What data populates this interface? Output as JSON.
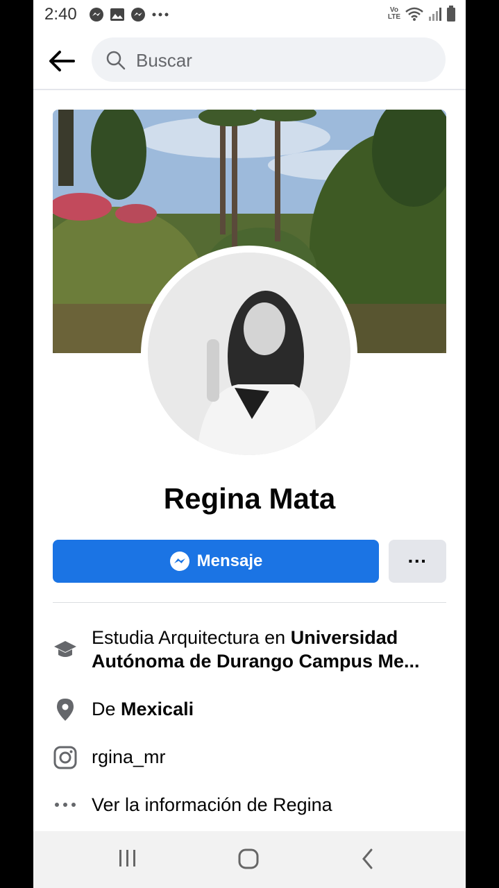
{
  "status_bar": {
    "time": "2:40",
    "left_icons": [
      "messenger-icon",
      "image-icon",
      "messenger-icon",
      "more-dots-icon"
    ],
    "right_icons": [
      "volte-icon",
      "wifi-icon",
      "signal-icon",
      "battery-icon"
    ],
    "volte_text": "Vo LTE"
  },
  "search": {
    "placeholder": "Buscar"
  },
  "profile": {
    "name": "Regina Mata",
    "message_button": "Mensaje",
    "more_button": "···"
  },
  "info": {
    "education_prefix": "Estudia Arquitectura en",
    "education_place": "Universidad Autónoma de Durango Campus Me...",
    "location_prefix": "De",
    "location_place": "Mexicali",
    "instagram": "rgina_mr",
    "see_more": "Ver la información de Regina"
  },
  "colors": {
    "accent": "#1b74e4",
    "button_grey": "#e4e6eb",
    "icon_grey": "#65676b"
  }
}
